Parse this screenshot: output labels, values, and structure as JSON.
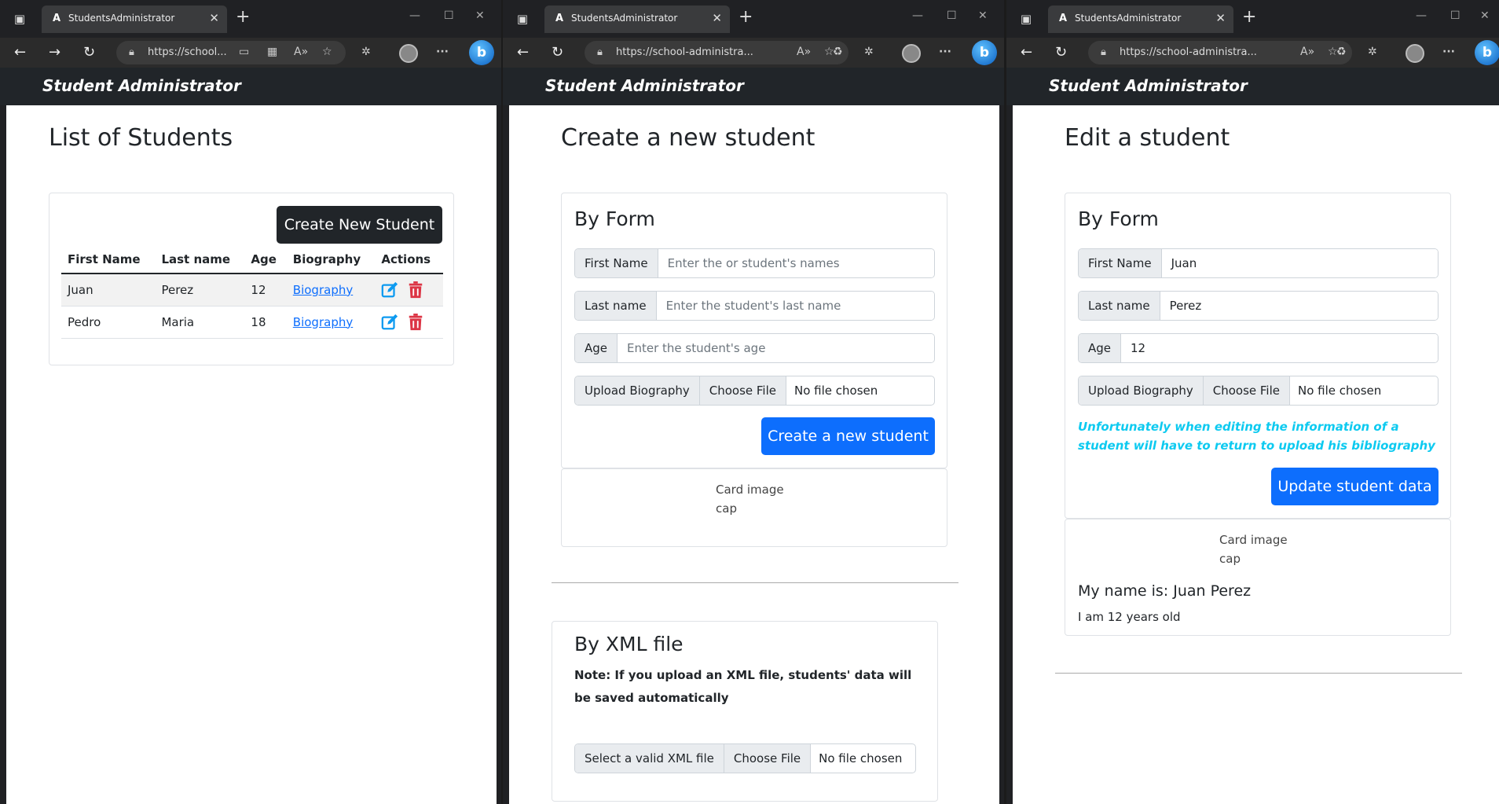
{
  "browser": {
    "tab_title": "StudentsAdministrator",
    "tab_favicon": "A",
    "url_short": "https://school...",
    "url_long": "https://school-administra...",
    "new_tab": "+",
    "close": "✕",
    "more": "···"
  },
  "app": {
    "brand": "Student Administrator"
  },
  "list_page": {
    "title": "List of Students",
    "create_button": "Create New Student",
    "columns": [
      "First Name",
      "Last name",
      "Age",
      "Biography",
      "Actions"
    ],
    "rows": [
      {
        "first": "Juan",
        "last": "Perez",
        "age": "12",
        "bio": "Biography"
      },
      {
        "first": "Pedro",
        "last": "Maria",
        "age": "18",
        "bio": "Biography"
      }
    ]
  },
  "create_page": {
    "title": "Create a new student",
    "form_header": "By Form",
    "first_label": "First Name",
    "first_placeholder": "Enter the or student's names",
    "last_label": "Last name",
    "last_placeholder": "Enter the student's last name",
    "age_label": "Age",
    "age_placeholder": "Enter the student's age",
    "upload_label": "Upload Biography",
    "choose_file": "Choose File",
    "no_file": "No file chosen",
    "submit": "Create a new student",
    "img_alt": "Card image cap",
    "xml_header": "By XML file",
    "xml_note": "Note: If you upload an XML file, students' data will be saved automatically",
    "xml_label": "Select a valid XML file",
    "xml_choose": "Choose File",
    "xml_no_file": "No file chosen"
  },
  "edit_page": {
    "title": "Edit a student",
    "form_header": "By Form",
    "first_label": "First Name",
    "first_value": "Juan",
    "last_label": "Last name",
    "last_value": "Perez",
    "age_label": "Age",
    "age_value": "12",
    "upload_label": "Upload Biography",
    "choose_file": "Choose File",
    "no_file": "No file chosen",
    "warning": "Unfortunately when editing the information of a student will have to return to upload his bibliography",
    "submit": "Update student data",
    "img_alt": "Card image cap",
    "card_title": "My name is: Juan Perez",
    "card_text": "I am 12 years old"
  },
  "colors": {
    "primary": "#0d6efd",
    "dark": "#212529",
    "info": "#0dcaf0",
    "danger": "#dc3545"
  },
  "icons": [
    "sidebar-icon",
    "back-icon",
    "forward-icon",
    "refresh-icon",
    "lock-icon",
    "read-aloud-icon",
    "favorite-icon",
    "extensions-icon",
    "profile-icon",
    "more-icon",
    "bing-icon",
    "edit-icon",
    "delete-icon"
  ]
}
